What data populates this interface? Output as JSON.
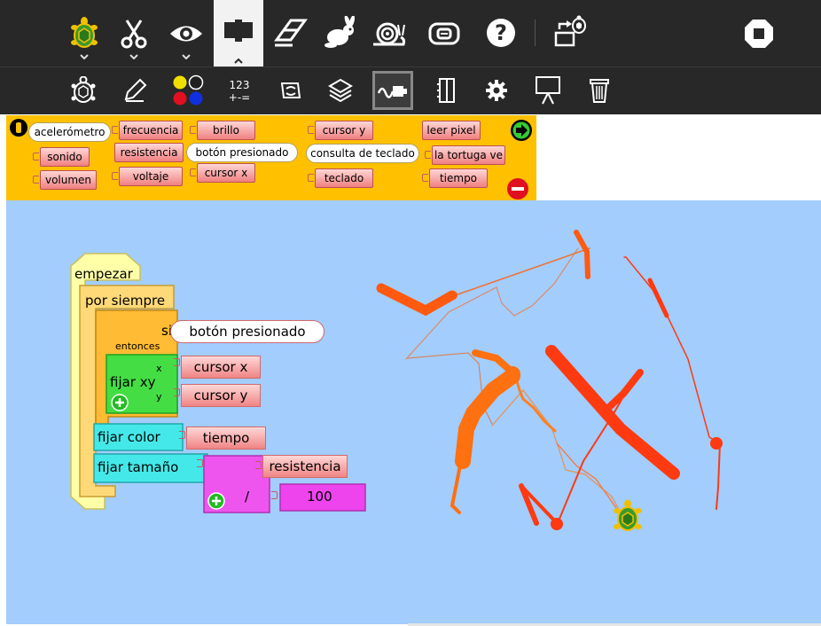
{
  "toolbar_main": {
    "buttons": [
      {
        "icon": "turtle-palette-icon",
        "active": false,
        "expand": true
      },
      {
        "icon": "scissors-icon",
        "active": false,
        "expand": true
      },
      {
        "icon": "eye-icon",
        "active": false,
        "expand": true
      },
      {
        "icon": "hardware-block-icon",
        "active": true,
        "expand": true
      },
      {
        "icon": "eraser-icon"
      },
      {
        "icon": "rabbit-icon"
      },
      {
        "icon": "snail-icon"
      },
      {
        "icon": "step-icon"
      },
      {
        "icon": "help-icon"
      },
      {
        "icon": "share-turtle-icon"
      },
      {
        "icon": "stop-icon"
      }
    ]
  },
  "toolbar_palettes": {
    "items": [
      {
        "icon": "turtle-icon",
        "label": ""
      },
      {
        "icon": "pen-icon",
        "label": ""
      },
      {
        "icon": "colors-icon",
        "label": ""
      },
      {
        "icon": "numbers-icon",
        "label": "123\n+-="
      },
      {
        "icon": "flow-icon",
        "label": ""
      },
      {
        "icon": "blocks-icon",
        "label": ""
      },
      {
        "icon": "sensors-icon",
        "label": "",
        "selected": true
      },
      {
        "icon": "media-icon",
        "label": ""
      },
      {
        "icon": "extras-icon",
        "label": ""
      },
      {
        "icon": "presentation-icon",
        "label": ""
      },
      {
        "icon": "trash-icon",
        "label": ""
      }
    ]
  },
  "palette": {
    "blocks": {
      "acelerometro": "acelerómetro",
      "sonido": "sonido",
      "volumen": "volumen",
      "frecuencia": "frecuencia",
      "resistencia": "resistencia",
      "voltaje": "voltaje",
      "brillo": "brillo",
      "boton_presionado": "botón presionado",
      "cursor_x": "cursor x",
      "cursor_y": "cursor y",
      "consulta_teclado": "consulta de teclado",
      "teclado": "teclado",
      "leer_pixel": "leer pixel",
      "la_tortuga_ve": "la tortuga ve",
      "tiempo": "tiempo"
    }
  },
  "program": {
    "start": "empezar",
    "forever": "por siempre",
    "if": "si",
    "then": "entonces",
    "condition": "botón presionado",
    "setxy": "fijar xy",
    "x_label": "x",
    "y_label": "y",
    "x_value": "cursor x",
    "y_value": "cursor y",
    "setcolor": "fijar color",
    "color_value": "tiempo",
    "setsize": "fijar tamaño",
    "size_numerator": "resistencia",
    "divide": "/",
    "size_denominator": "100"
  },
  "colors": {
    "toolbar": "#282828",
    "palette_bg": "#ffc000",
    "canvas_bg": "#a2cdfd",
    "sensor_block": "#f08080",
    "start_block": "#ffff99",
    "flow_block": "#ffc040",
    "motion_block": "#44dd44",
    "pen_block": "#44e8e8",
    "number_block": "#ee44ee",
    "turtle": "#55aa33"
  }
}
